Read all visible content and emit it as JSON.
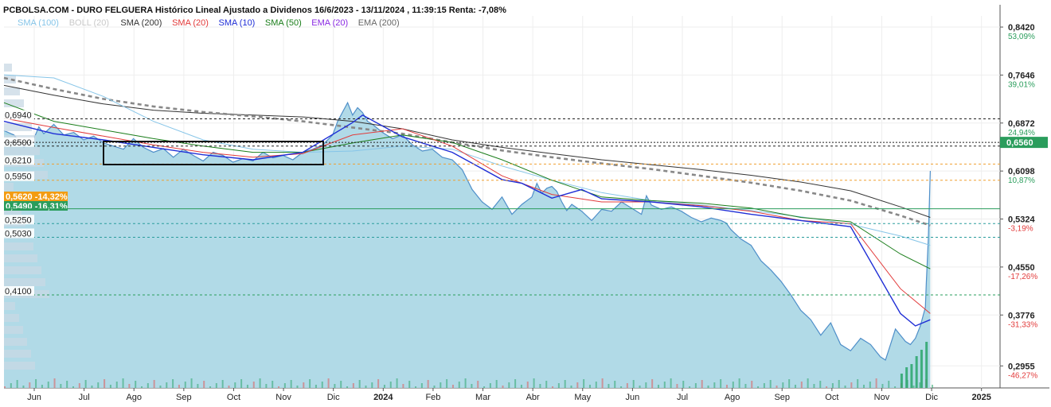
{
  "header": {
    "title": "PCBOLSA.COM - DURO FELGUERA Histórico Lineal Ajustado a Dividenos 16/6/2023 - 13/11/2024 , 11:39:15 Renta: -7,08%"
  },
  "legend": [
    {
      "label": "SMA (100)",
      "color": "#86c5e8"
    },
    {
      "label": "BOLL (20)",
      "color": "#c9c9c9"
    },
    {
      "label": "SMA (200)",
      "color": "#333333"
    },
    {
      "label": "SMA (20)",
      "color": "#e23b3b"
    },
    {
      "label": "SMA (10)",
      "color": "#1f2ed6"
    },
    {
      "label": "SMA (50)",
      "color": "#1a7d1a"
    },
    {
      "label": "EMA (20)",
      "color": "#8a2be2"
    },
    {
      "label": "EMA (200)",
      "color": "#666666"
    }
  ],
  "chart_data": {
    "type": "area",
    "title": "DURO FELGUERA Histórico Lineal Ajustado a Dividenos 16/6/2023 - 13/11/2024",
    "x_ticks": [
      "Jun",
      "Jul",
      "Ago",
      "Sep",
      "Oct",
      "Nov",
      "Dic",
      "2024",
      "Feb",
      "Mar",
      "Abr",
      "May",
      "Jun",
      "Jul",
      "Ago",
      "Sep",
      "Oct",
      "Nov",
      "Dic",
      "2025"
    ],
    "right_axis": [
      {
        "price": "0,8420",
        "pct": "53,09%",
        "pct_color": "#2a9d5c"
      },
      {
        "price": "0,7646",
        "pct": "39,01%",
        "pct_color": "#2a9d5c"
      },
      {
        "price": "0,6872",
        "pct": "24,94%",
        "pct_color": "#2a9d5c"
      },
      {
        "price": "0,6098",
        "pct": "10,87%",
        "pct_color": "#2a9d5c"
      },
      {
        "price": "0,5324",
        "pct": "-3,19%",
        "pct_color": "#e23b3b"
      },
      {
        "price": "0,4550",
        "pct": "-17,26%",
        "pct_color": "#e23b3b"
      },
      {
        "price": "0,3776",
        "pct": "-31,33%",
        "pct_color": "#e23b3b"
      },
      {
        "price": "0,2955",
        "pct": "-46,27%",
        "pct_color": "#e23b3b"
      }
    ],
    "current_price": "0,6560",
    "left_levels": [
      "0,6940",
      "0,6500",
      "0,6210",
      "0,5950",
      "0,5250",
      "0,5030",
      "0,4100"
    ],
    "tags": [
      {
        "text": "0,5620  -14,32%",
        "color": "#f39c12"
      },
      {
        "text": "0,5490  -16,31%",
        "color": "#2a9d5c"
      }
    ],
    "ylim": [
      0.26,
      0.86
    ],
    "series": [
      {
        "name": "DURO FELGUERA",
        "x": [
          0,
          0.01,
          0.02,
          0.03,
          0.035,
          0.04,
          0.05,
          0.06,
          0.07,
          0.08,
          0.09,
          0.1,
          0.11,
          0.12,
          0.13,
          0.14,
          0.15,
          0.16,
          0.17,
          0.18,
          0.19,
          0.2,
          0.21,
          0.22,
          0.23,
          0.24,
          0.25,
          0.26,
          0.27,
          0.28,
          0.29,
          0.3,
          0.31,
          0.32,
          0.33,
          0.335,
          0.34,
          0.345,
          0.35,
          0.355,
          0.36,
          0.365,
          0.37,
          0.38,
          0.39,
          0.4,
          0.41,
          0.42,
          0.43,
          0.44,
          0.45,
          0.46,
          0.47,
          0.48,
          0.49,
          0.5,
          0.51,
          0.52,
          0.53,
          0.535,
          0.54,
          0.545,
          0.55,
          0.555,
          0.56,
          0.565,
          0.57,
          0.58,
          0.59,
          0.6,
          0.61,
          0.62,
          0.63,
          0.64,
          0.645,
          0.65,
          0.66,
          0.67,
          0.68,
          0.69,
          0.7,
          0.71,
          0.72,
          0.725,
          0.73,
          0.74,
          0.75,
          0.76,
          0.77,
          0.78,
          0.79,
          0.8,
          0.81,
          0.82,
          0.83,
          0.84,
          0.85,
          0.86,
          0.87,
          0.875,
          0.88,
          0.885,
          0.89,
          0.895,
          0.9,
          0.905,
          0.91,
          0.915,
          0.92,
          0.925,
          0.926,
          0.928,
          0.93
        ],
        "values": [
          0.675,
          0.668,
          0.648,
          0.662,
          0.681,
          0.67,
          0.685,
          0.668,
          0.672,
          0.66,
          0.666,
          0.655,
          0.65,
          0.645,
          0.662,
          0.648,
          0.64,
          0.646,
          0.632,
          0.645,
          0.635,
          0.626,
          0.64,
          0.635,
          0.624,
          0.63,
          0.626,
          0.64,
          0.631,
          0.635,
          0.628,
          0.64,
          0.645,
          0.652,
          0.668,
          0.69,
          0.705,
          0.72,
          0.7,
          0.712,
          0.704,
          0.69,
          0.685,
          0.672,
          0.662,
          0.668,
          0.652,
          0.642,
          0.645,
          0.632,
          0.628,
          0.612,
          0.58,
          0.56,
          0.548,
          0.568,
          0.54,
          0.556,
          0.568,
          0.59,
          0.574,
          0.582,
          0.585,
          0.577,
          0.56,
          0.546,
          0.556,
          0.545,
          0.53,
          0.548,
          0.545,
          0.56,
          0.55,
          0.54,
          0.57,
          0.555,
          0.548,
          0.552,
          0.545,
          0.535,
          0.528,
          0.534,
          0.53,
          0.526,
          0.515,
          0.5,
          0.49,
          0.465,
          0.45,
          0.432,
          0.41,
          0.385,
          0.37,
          0.345,
          0.365,
          0.33,
          0.32,
          0.34,
          0.33,
          0.32,
          0.31,
          0.305,
          0.33,
          0.355,
          0.345,
          0.335,
          0.33,
          0.34,
          0.36,
          0.39,
          0.43,
          0.5,
          0.61
        ]
      },
      {
        "name": "SMA (200)",
        "x": [
          0,
          0.05,
          0.1,
          0.15,
          0.2,
          0.25,
          0.3,
          0.35,
          0.4,
          0.45,
          0.5,
          0.55,
          0.6,
          0.65,
          0.7,
          0.75,
          0.8,
          0.85,
          0.9,
          0.93
        ],
        "values": [
          0.748,
          0.732,
          0.718,
          0.708,
          0.703,
          0.7,
          0.697,
          0.69,
          0.678,
          0.66,
          0.648,
          0.638,
          0.628,
          0.62,
          0.612,
          0.603,
          0.592,
          0.578,
          0.552,
          0.535
        ]
      },
      {
        "name": "EMA (200)",
        "x": [
          0,
          0.05,
          0.1,
          0.15,
          0.2,
          0.25,
          0.3,
          0.35,
          0.4,
          0.45,
          0.5,
          0.55,
          0.6,
          0.65,
          0.7,
          0.75,
          0.8,
          0.85,
          0.9,
          0.93
        ],
        "values": [
          0.76,
          0.742,
          0.726,
          0.714,
          0.705,
          0.698,
          0.69,
          0.68,
          0.67,
          0.656,
          0.643,
          0.632,
          0.622,
          0.613,
          0.602,
          0.591,
          0.578,
          0.562,
          0.538,
          0.522
        ]
      },
      {
        "name": "SMA (100)",
        "x": [
          0,
          0.05,
          0.1,
          0.15,
          0.2,
          0.25,
          0.3,
          0.35,
          0.4,
          0.45,
          0.5,
          0.55,
          0.6,
          0.65,
          0.7,
          0.75,
          0.8,
          0.85,
          0.9,
          0.93
        ],
        "values": [
          0.765,
          0.76,
          0.73,
          0.69,
          0.66,
          0.645,
          0.64,
          0.642,
          0.65,
          0.645,
          0.618,
          0.595,
          0.575,
          0.562,
          0.555,
          0.546,
          0.536,
          0.524,
          0.505,
          0.49
        ]
      },
      {
        "name": "SMA (50)",
        "x": [
          0,
          0.05,
          0.1,
          0.15,
          0.2,
          0.25,
          0.3,
          0.35,
          0.4,
          0.45,
          0.5,
          0.55,
          0.6,
          0.65,
          0.7,
          0.75,
          0.8,
          0.85,
          0.9,
          0.93
        ],
        "values": [
          0.72,
          0.69,
          0.676,
          0.662,
          0.65,
          0.64,
          0.64,
          0.655,
          0.668,
          0.656,
          0.628,
          0.595,
          0.568,
          0.562,
          0.558,
          0.55,
          0.535,
          0.528,
          0.476,
          0.452
        ]
      },
      {
        "name": "SMA (20)",
        "x": [
          0,
          0.05,
          0.1,
          0.15,
          0.2,
          0.25,
          0.3,
          0.35,
          0.4,
          0.45,
          0.5,
          0.55,
          0.6,
          0.65,
          0.7,
          0.75,
          0.8,
          0.85,
          0.9,
          0.93
        ],
        "values": [
          0.695,
          0.68,
          0.666,
          0.652,
          0.64,
          0.632,
          0.638,
          0.668,
          0.678,
          0.65,
          0.602,
          0.572,
          0.56,
          0.56,
          0.554,
          0.545,
          0.53,
          0.525,
          0.42,
          0.38
        ]
      },
      {
        "name": "SMA (10)",
        "x": [
          0,
          0.05,
          0.1,
          0.15,
          0.2,
          0.25,
          0.3,
          0.35,
          0.36,
          0.4,
          0.45,
          0.5,
          0.52,
          0.55,
          0.58,
          0.6,
          0.65,
          0.7,
          0.75,
          0.8,
          0.85,
          0.9,
          0.915,
          0.93
        ],
        "values": [
          0.69,
          0.67,
          0.66,
          0.648,
          0.636,
          0.628,
          0.64,
          0.688,
          0.7,
          0.665,
          0.64,
          0.596,
          0.59,
          0.566,
          0.58,
          0.565,
          0.56,
          0.552,
          0.54,
          0.53,
          0.52,
          0.38,
          0.36,
          0.37
        ]
      }
    ]
  },
  "colors": {
    "area_fill": "#add8e6",
    "area_line": "#4f8fc9",
    "volume_up": "#2aa56a",
    "volume_down": "#e05a5a"
  }
}
